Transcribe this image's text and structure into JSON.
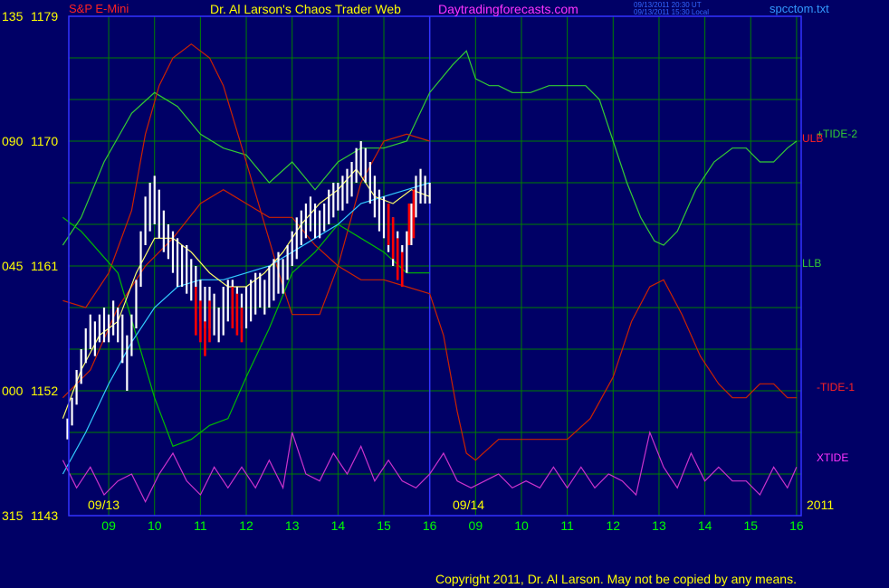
{
  "header": {
    "symbol": "S&P E-Mini",
    "title": "Dr. Al Larson's Chaos Trader Web",
    "website": "Daytradingforecasts.com",
    "timestamp_ut": "09/13/2011 20:30 UT",
    "timestamp_local": "09/13/2011 15:30 Local",
    "filename": "spcctom.txt"
  },
  "footer": {
    "copyright": "Copyright 2011, Dr. Al Larson. May not be copied by any means."
  },
  "colors": {
    "background": "#000066",
    "grid": "#008000",
    "price_bar_up": "#ffffff",
    "price_bar_down": "#ff0000",
    "tide_2": "#33cc33",
    "tide_1": "#cc2200",
    "xtide": "#cc33cc",
    "ulb": "#cc2200",
    "llb": "#00bb00",
    "fast_average": "#ffff66",
    "slow_average": "#33ccff",
    "session_divider": "#3333ff"
  },
  "chart_data": {
    "type": "line",
    "title": "S&P E-Mini",
    "y_axis": {
      "range": [
        1143,
        1179
      ],
      "tick_labels": [
        {
          "angle": "135",
          "price": "1179",
          "value": 1179
        },
        {
          "angle": "090",
          "price": "1170",
          "value": 1170
        },
        {
          "angle": "045",
          "price": "1161",
          "value": 1161
        },
        {
          "angle": "000",
          "price": "1152",
          "value": 1152
        },
        {
          "angle": "315",
          "price": "1143",
          "value": 1143
        }
      ]
    },
    "x_axis": {
      "sessions": [
        "09/13",
        "09/14"
      ],
      "year": "2011",
      "hour_labels": [
        "09",
        "10",
        "11",
        "12",
        "13",
        "14",
        "15",
        "16",
        "09",
        "10",
        "11",
        "12",
        "13",
        "14",
        "15",
        "16"
      ],
      "hour_index": [
        1,
        2,
        3,
        4,
        5,
        6,
        7,
        8,
        9,
        10,
        11,
        12,
        13,
        14,
        15,
        16
      ],
      "range": [
        0.13,
        16.1
      ],
      "session_break": 8.0
    },
    "grid": true,
    "legend": [
      {
        "label": "+TIDE-2",
        "color": "#33cc33"
      },
      {
        "label": "ULB",
        "color": "#cc2200"
      },
      {
        "label": "LLB",
        "color": "#00bb00"
      },
      {
        "label": "-TIDE-1",
        "color": "#cc2200"
      },
      {
        "label": "XTIDE",
        "color": "#cc33cc"
      }
    ],
    "series": [
      {
        "name": "+TIDE-2",
        "x": [
          0,
          0.4,
          0.9,
          1.5,
          2.0,
          2.5,
          3.0,
          3.5,
          4.0,
          4.5,
          5.0,
          5.5,
          6.0,
          6.5,
          7.0,
          7.5,
          8.0,
          8.5,
          8.8,
          9.0,
          9.3,
          9.5,
          9.8,
          10.2,
          10.6,
          11.0,
          11.4,
          11.7,
          12.0,
          12.3,
          12.6,
          12.9,
          13.1,
          13.4,
          13.8,
          14.2,
          14.6,
          14.9,
          15.2,
          15.5,
          15.8,
          16.0
        ],
        "y": [
          1162.5,
          1164.5,
          1168.5,
          1172,
          1173.5,
          1172.5,
          1170.5,
          1169.5,
          1169,
          1167,
          1168.5,
          1166.5,
          1168.5,
          1169.5,
          1169.5,
          1170,
          1173.5,
          1175.5,
          1176.5,
          1174.5,
          1174,
          1174,
          1173.5,
          1173.5,
          1174,
          1174,
          1174,
          1173,
          1170,
          1167,
          1164.5,
          1162.8,
          1162.5,
          1163.5,
          1166.5,
          1168.5,
          1169.5,
          1169.5,
          1168.5,
          1168.5,
          1169.5,
          1170
        ]
      },
      {
        "name": "-TIDE-1",
        "x": [
          0,
          0.6,
          1.2,
          1.8,
          2.4,
          3.0,
          3.5,
          4.0,
          4.5,
          5.0,
          5.5,
          6.0,
          6.5,
          7.0,
          7.5,
          8.0,
          8.3,
          8.6,
          8.8,
          9.0,
          9.5,
          10.0,
          10.5,
          11.0,
          11.5,
          12.0,
          12.4,
          12.8,
          13.1,
          13.5,
          13.9,
          14.3,
          14.6,
          14.9,
          15.2,
          15.5,
          15.8,
          16.0
        ],
        "y": [
          1151.5,
          1153.5,
          1158,
          1161,
          1163,
          1165.5,
          1166.5,
          1165.5,
          1164.5,
          1164.5,
          1162.5,
          1161,
          1160,
          1160,
          1159.5,
          1159,
          1156,
          1150.5,
          1147.5,
          1147,
          1148.5,
          1148.5,
          1148.5,
          1148.5,
          1150,
          1153,
          1157,
          1159.5,
          1160,
          1157.5,
          1154.5,
          1152.5,
          1151.5,
          1151.5,
          1152.5,
          1152.5,
          1151.5,
          1151.5
        ]
      },
      {
        "name": "ULB",
        "x": [
          0,
          0.5,
          1.0,
          1.5,
          1.8,
          2.1,
          2.4,
          2.8,
          3.2,
          3.5,
          4.0,
          4.4,
          4.8,
          5.0,
          5.3,
          5.6,
          6.0,
          6.5,
          7.0,
          7.5,
          8.0
        ],
        "y": [
          1158.5,
          1158,
          1160.5,
          1165,
          1170.5,
          1174,
          1176,
          1177,
          1176,
          1174,
          1168.5,
          1164,
          1159.5,
          1157.5,
          1157.5,
          1157.5,
          1161,
          1167,
          1170,
          1170.5,
          1170
        ]
      },
      {
        "name": "LLB",
        "x": [
          0,
          0.4,
          0.8,
          1.2,
          1.6,
          2.0,
          2.4,
          2.8,
          3.2,
          3.6,
          4.0,
          4.5,
          5.0,
          5.5,
          6.0,
          6.5,
          7.0,
          7.5,
          8.0
        ],
        "y": [
          1164.5,
          1163.5,
          1162,
          1160.5,
          1156,
          1151.5,
          1148,
          1148.5,
          1149.5,
          1150,
          1153,
          1156.5,
          1160.5,
          1162,
          1164,
          1163,
          1162,
          1160.5,
          1160.5
        ]
      },
      {
        "name": "Slow average",
        "x": [
          0,
          0.5,
          1.0,
          1.5,
          2.0,
          2.5,
          3.0,
          3.5,
          4.0,
          4.5,
          5.0,
          5.5,
          6.0,
          6.5,
          7.0,
          7.5,
          8.0
        ],
        "y": [
          1146,
          1149,
          1152.5,
          1155.5,
          1158,
          1159.5,
          1160,
          1160,
          1160.5,
          1161,
          1162,
          1163,
          1164,
          1165.5,
          1166,
          1166.5,
          1167
        ]
      },
      {
        "name": "Fast average",
        "x": [
          0,
          0.4,
          0.8,
          1.2,
          1.6,
          2.0,
          2.4,
          2.8,
          3.2,
          3.6,
          4.0,
          4.4,
          4.8,
          5.2,
          5.6,
          6.0,
          6.4,
          6.8,
          7.2,
          7.6,
          8.0
        ],
        "y": [
          1150,
          1153.5,
          1156,
          1157,
          1160.5,
          1163,
          1163,
          1162,
          1160.5,
          1159.5,
          1159.5,
          1160.5,
          1162,
          1164,
          1165.5,
          1166.5,
          1168,
          1166,
          1165.5,
          1166.5,
          1166
        ]
      },
      {
        "name": "XTIDE",
        "x": [
          0,
          0.3,
          0.6,
          0.9,
          1.2,
          1.5,
          1.8,
          2.1,
          2.4,
          2.7,
          3.0,
          3.3,
          3.6,
          3.9,
          4.2,
          4.5,
          4.8,
          5.0,
          5.3,
          5.6,
          5.9,
          6.2,
          6.5,
          6.8,
          7.1,
          7.4,
          7.7,
          8.0,
          8.3,
          8.6,
          8.9,
          9.2,
          9.5,
          9.8,
          10.1,
          10.4,
          10.7,
          11.0,
          11.3,
          11.6,
          11.9,
          12.2,
          12.5,
          12.8,
          13.1,
          13.4,
          13.7,
          14.0,
          14.3,
          14.6,
          14.9,
          15.2,
          15.5,
          15.8,
          16.0
        ],
        "y": [
          1147,
          1145,
          1146.5,
          1144.5,
          1145.5,
          1146,
          1144,
          1146,
          1147.5,
          1145.5,
          1144.5,
          1146.5,
          1145,
          1146.5,
          1145,
          1147,
          1145,
          1149,
          1146,
          1145.5,
          1147.5,
          1146,
          1148,
          1145.5,
          1147,
          1145.5,
          1145,
          1146,
          1147.5,
          1145.5,
          1145,
          1145.5,
          1146,
          1145,
          1145.5,
          1145,
          1146.5,
          1145,
          1146.5,
          1145,
          1146,
          1145.5,
          1144.5,
          1149,
          1146.5,
          1145,
          1147.5,
          1145.5,
          1146.5,
          1145.5,
          1145.5,
          1144.5,
          1146.5,
          1145,
          1146.5
        ]
      }
    ],
    "price_bars": [
      [
        0.1,
        1150.0,
        1148.5
      ],
      [
        0.2,
        1151.5,
        1149.5
      ],
      [
        0.3,
        1153.5,
        1151.0
      ],
      [
        0.4,
        1155.0,
        1152.5
      ],
      [
        0.5,
        1156.5,
        1154.0
      ],
      [
        0.6,
        1157.5,
        1155.0
      ],
      [
        0.7,
        1157.0,
        1154.5
      ],
      [
        0.8,
        1157.5,
        1155.5
      ],
      [
        0.9,
        1158.0,
        1155.5
      ],
      [
        1.0,
        1157.5,
        1155.5
      ],
      [
        1.1,
        1158.5,
        1156.0
      ],
      [
        1.2,
        1158.0,
        1155.5
      ],
      [
        1.3,
        1157.5,
        1154.0
      ],
      [
        1.4,
        1156.0,
        1152.0
      ],
      [
        1.5,
        1157.5,
        1154.5
      ],
      [
        1.6,
        1160.0,
        1156.5
      ],
      [
        1.7,
        1163.5,
        1159.5
      ],
      [
        1.8,
        1166.0,
        1162.5
      ],
      [
        1.9,
        1167.0,
        1163.5
      ],
      [
        2.0,
        1167.5,
        1164.0
      ],
      [
        2.1,
        1166.5,
        1163.0
      ],
      [
        2.2,
        1165.0,
        1162.0
      ],
      [
        2.3,
        1164.0,
        1161.5
      ],
      [
        2.4,
        1163.5,
        1160.5
      ],
      [
        2.5,
        1163.0,
        1159.5
      ],
      [
        2.6,
        1162.5,
        1159.5
      ],
      [
        2.7,
        1162.5,
        1159.0
      ],
      [
        2.8,
        1161.5,
        1158.5
      ],
      [
        2.9,
        1161.0,
        1157.5
      ],
      [
        3.0,
        1160.0,
        1157.0
      ],
      [
        3.1,
        1159.5,
        1156.5
      ],
      [
        3.2,
        1159.5,
        1156.5
      ],
      [
        3.3,
        1159.0,
        1156.0
      ],
      [
        3.4,
        1158.0,
        1155.5
      ],
      [
        3.5,
        1159.5,
        1156.0
      ],
      [
        3.6,
        1160.0,
        1157.0
      ],
      [
        3.7,
        1160.0,
        1157.5
      ],
      [
        3.8,
        1159.5,
        1157.0
      ],
      [
        3.9,
        1159.0,
        1156.5
      ],
      [
        4.0,
        1159.5,
        1156.5
      ],
      [
        4.1,
        1160.0,
        1157.0
      ],
      [
        4.2,
        1160.5,
        1157.5
      ],
      [
        4.3,
        1160.5,
        1158.0
      ],
      [
        4.4,
        1160.0,
        1157.5
      ],
      [
        4.5,
        1161.0,
        1158.0
      ],
      [
        4.6,
        1161.5,
        1158.5
      ],
      [
        4.7,
        1162.0,
        1159.0
      ],
      [
        4.8,
        1161.5,
        1159.0
      ],
      [
        4.9,
        1162.5,
        1160.0
      ],
      [
        5.0,
        1163.5,
        1161.0
      ],
      [
        5.1,
        1164.5,
        1161.5
      ],
      [
        5.2,
        1165.0,
        1162.5
      ],
      [
        5.3,
        1165.5,
        1163.0
      ],
      [
        5.4,
        1166.0,
        1163.5
      ],
      [
        5.5,
        1165.5,
        1163.0
      ],
      [
        5.6,
        1165.0,
        1163.0
      ],
      [
        5.7,
        1165.5,
        1163.5
      ],
      [
        5.8,
        1166.5,
        1164.0
      ],
      [
        5.9,
        1167.0,
        1164.5
      ],
      [
        6.0,
        1167.0,
        1165.0
      ],
      [
        6.1,
        1167.5,
        1165.0
      ],
      [
        6.2,
        1168.0,
        1165.5
      ],
      [
        6.3,
        1168.5,
        1166.0
      ],
      [
        6.4,
        1169.5,
        1167.0
      ],
      [
        6.5,
        1170.0,
        1167.5
      ],
      [
        6.6,
        1169.5,
        1167.0
      ],
      [
        6.7,
        1168.5,
        1165.5
      ],
      [
        6.8,
        1167.5,
        1164.5
      ],
      [
        6.9,
        1166.5,
        1163.5
      ],
      [
        7.0,
        1166.0,
        1163.0
      ],
      [
        7.1,
        1165.5,
        1162.0
      ],
      [
        7.2,
        1164.5,
        1161.0
      ],
      [
        7.3,
        1163.5,
        1160.0
      ],
      [
        7.4,
        1162.5,
        1159.5
      ],
      [
        7.5,
        1163.5,
        1160.5
      ],
      [
        7.6,
        1165.5,
        1162.5
      ],
      [
        7.7,
        1167.5,
        1164.5
      ],
      [
        7.8,
        1168.0,
        1165.5
      ],
      [
        7.9,
        1167.5,
        1165.5
      ],
      [
        8.0,
        1167.0,
        1165.5
      ]
    ],
    "down_bars": [
      [
        2.9,
        1159.5,
        1156.0
      ],
      [
        3.0,
        1158.5,
        1155.5
      ],
      [
        3.1,
        1157.0,
        1154.5
      ],
      [
        3.2,
        1158.5,
        1155.5
      ],
      [
        3.7,
        1159.5,
        1156.5
      ],
      [
        3.8,
        1159.0,
        1156.0
      ],
      [
        3.9,
        1158.0,
        1155.5
      ],
      [
        7.1,
        1165.5,
        1162.5
      ],
      [
        7.2,
        1164.5,
        1161.5
      ],
      [
        7.3,
        1163.0,
        1160.0
      ],
      [
        7.4,
        1162.0,
        1159.5
      ],
      [
        7.55,
        1165.5,
        1162.5
      ],
      [
        7.65,
        1166.5,
        1163.0
      ]
    ],
    "annotations": [
      "+TIDE-2",
      "ULB",
      "LLB",
      "-TIDE-1",
      "XTIDE"
    ]
  }
}
